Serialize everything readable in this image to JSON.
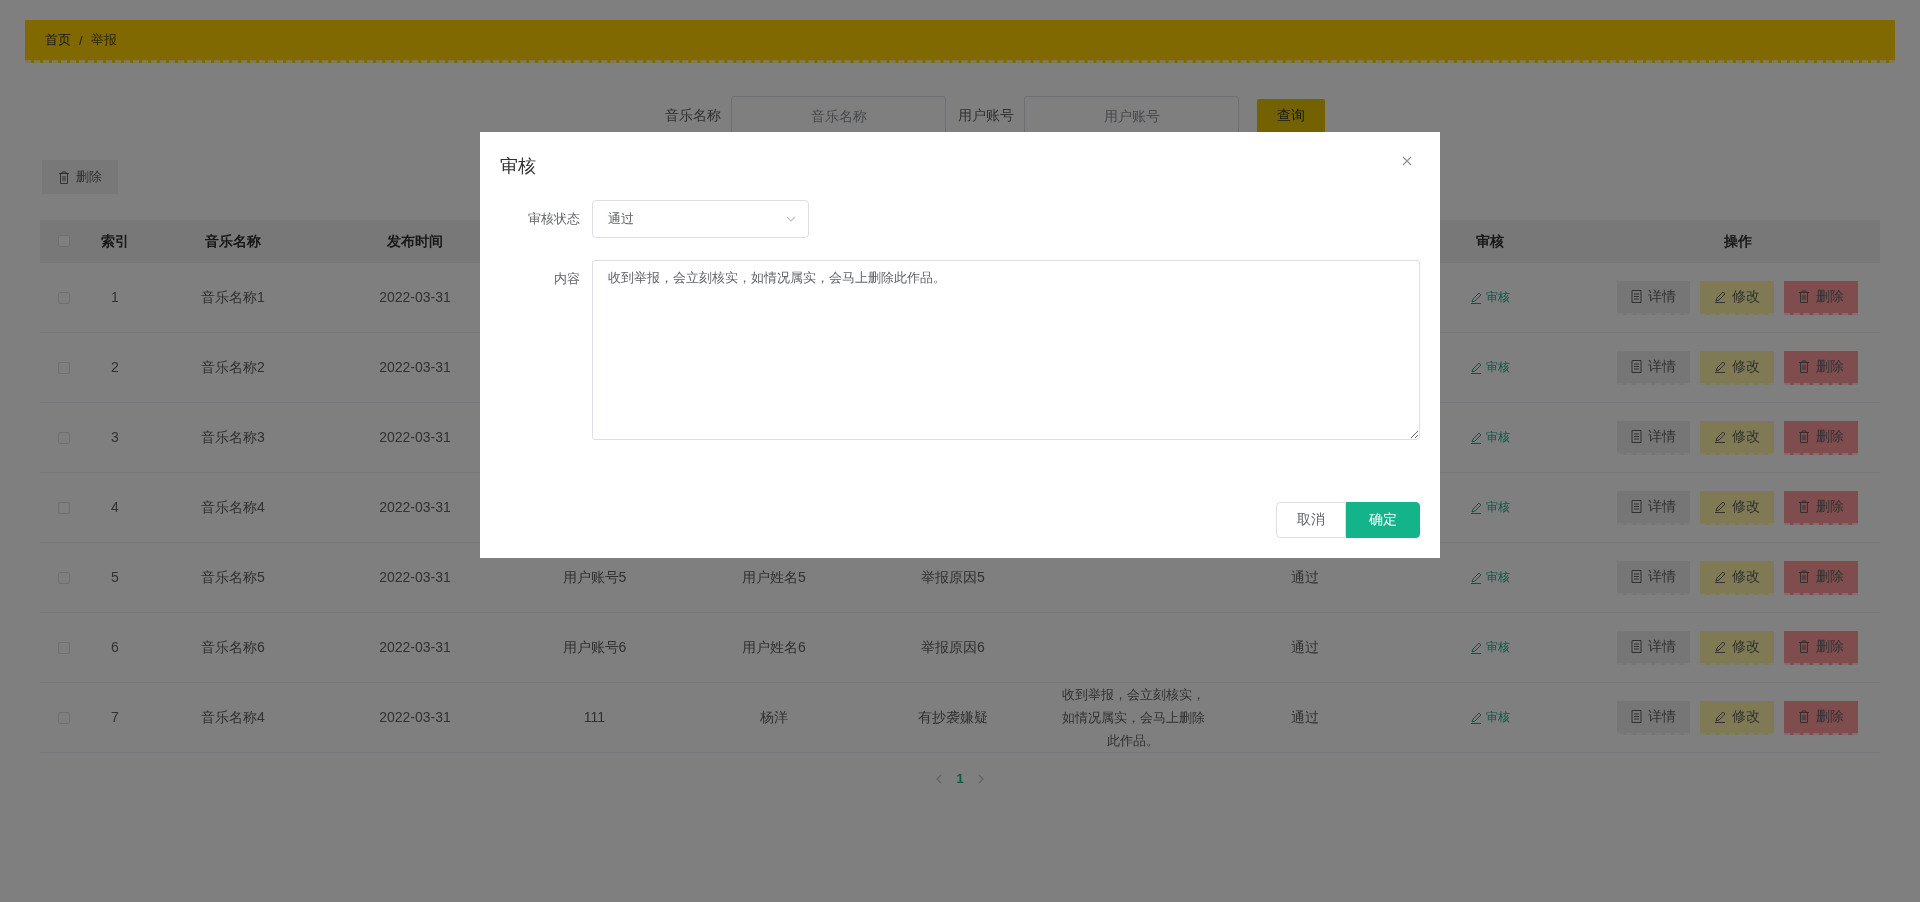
{
  "breadcrumb": {
    "items": [
      {
        "label": "首页"
      },
      {
        "label": "举报"
      }
    ],
    "separator": "/"
  },
  "search": {
    "fields": [
      {
        "label": "音乐名称",
        "placeholder": "音乐名称"
      },
      {
        "label": "用户账号",
        "placeholder": "用户账号"
      }
    ],
    "button": "查询"
  },
  "toolbar": {
    "delete_button": "删除"
  },
  "table": {
    "all_checked": false,
    "columns": [
      "索引",
      "音乐名称",
      "发布时间",
      null,
      null,
      null,
      null,
      null,
      "审核",
      "操作"
    ],
    "rows": [
      {
        "checked": false,
        "cells": [
          "1",
          "音乐名称1",
          "2022-03-31",
          null,
          null,
          null,
          null,
          null
        ],
        "review": "审核",
        "actions": [
          "详情",
          "修改",
          "删除"
        ]
      },
      {
        "checked": false,
        "cells": [
          "2",
          "音乐名称2",
          "2022-03-31",
          null,
          null,
          null,
          null,
          null
        ],
        "review": "审核",
        "actions": [
          "详情",
          "修改",
          "删除"
        ]
      },
      {
        "checked": false,
        "cells": [
          "3",
          "音乐名称3",
          "2022-03-31",
          null,
          null,
          null,
          null,
          null
        ],
        "review": "审核",
        "actions": [
          "详情",
          "修改",
          "删除"
        ]
      },
      {
        "checked": false,
        "cells": [
          "4",
          "音乐名称4",
          "2022-03-31",
          null,
          null,
          null,
          null,
          null
        ],
        "review": "审核",
        "actions": [
          "详情",
          "修改",
          "删除"
        ]
      },
      {
        "checked": false,
        "cells": [
          "5",
          "音乐名称5",
          "2022-03-31",
          "用户账号5",
          "用户姓名5",
          "举报原因5",
          null,
          "通过"
        ],
        "review": "审核",
        "actions": [
          "详情",
          "修改",
          "删除"
        ]
      },
      {
        "checked": false,
        "cells": [
          "6",
          "音乐名称6",
          "2022-03-31",
          "用户账号6",
          "用户姓名6",
          "举报原因6",
          null,
          "通过"
        ],
        "review": "审核",
        "actions": [
          "详情",
          "修改",
          "删除"
        ]
      },
      {
        "checked": false,
        "cells": [
          "7",
          "音乐名称4",
          "2022-03-31",
          "111",
          "杨洋",
          "有抄袭嫌疑",
          "收到举报，会立刻核实，如情况属实，会马上删除此作品。",
          "通过"
        ],
        "review": "审核",
        "actions": [
          "详情",
          "修改",
          "删除"
        ]
      }
    ]
  },
  "pagination": {
    "pages": [
      {
        "label": "1",
        "selected": true
      }
    ]
  },
  "dialog": {
    "title": "审核",
    "fields": [
      {
        "kind": "select",
        "label": "审核状态",
        "value": "通过"
      },
      {
        "kind": "textarea",
        "label": "内容",
        "value": "收到举报，会立刻核实，如情况属实，会马上删除此作品。"
      }
    ],
    "buttons": [
      {
        "kind": "default",
        "label": "取消"
      },
      {
        "kind": "primary",
        "label": "确定"
      }
    ]
  }
}
